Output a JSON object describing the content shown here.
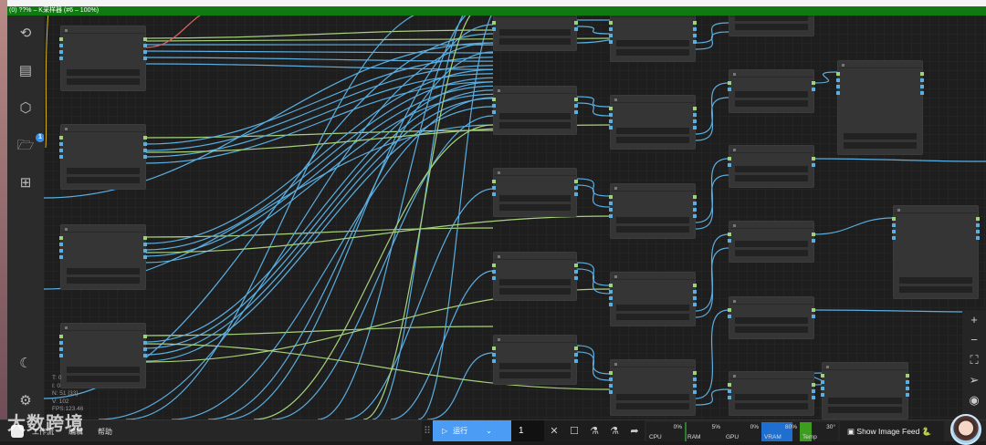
{
  "title_bar": {
    "text": "(0) ??% – K采样器 (#6 – 100%)"
  },
  "sidebar": {
    "items": [
      {
        "name": "history-icon",
        "glyph": "⟲"
      },
      {
        "name": "book-icon",
        "glyph": "▤"
      },
      {
        "name": "cube-icon",
        "glyph": "⬡"
      },
      {
        "name": "folder-icon",
        "glyph": "🗁",
        "badge": "1"
      },
      {
        "name": "tree-icon",
        "glyph": "⊞"
      }
    ],
    "theme_glyph": "☾",
    "settings_glyph": "⚙"
  },
  "stats": {
    "t": "T: 0",
    "i": "I: 0",
    "n": "N: 51 [33]",
    "v": "V: 102",
    "fps": "FPS:123.46"
  },
  "menu": {
    "workflow": "工作流",
    "edit": "编辑",
    "help": "帮助"
  },
  "watermark": "大数跨境",
  "toolbar": {
    "run_label": "运行",
    "run_icon": "▷",
    "dropdown_icon": "⌄",
    "count": "1",
    "cancel_icon": "✕",
    "stop_icon": "☐",
    "share_icon": "➦"
  },
  "meters": [
    {
      "label": "CPU",
      "value": "0%",
      "fraction": 0,
      "color": "#2e7d32"
    },
    {
      "label": "RAM",
      "value": "5%",
      "fraction": 0.05,
      "color": "#2e7d32"
    },
    {
      "label": "GPU",
      "value": "0%",
      "fraction": 0,
      "color": "#2e7d32"
    },
    {
      "label": "VRAM",
      "value": "80%",
      "fraction": 0.8,
      "color": "#1e6fd0"
    },
    {
      "label": "Temp",
      "value": "30°",
      "fraction": 0.3,
      "color": "#3c9d1f"
    }
  ],
  "feed": {
    "label": "Show Image Feed 🐍"
  },
  "zoom_controls": [
    "+",
    "−",
    "⛶",
    "➢",
    "◉"
  ],
  "colors": {
    "wire_blue": "#5aaee0",
    "wire_green": "#a6d17a",
    "wire_red": "#e06060",
    "wire_yellow": "#d9b51a"
  }
}
